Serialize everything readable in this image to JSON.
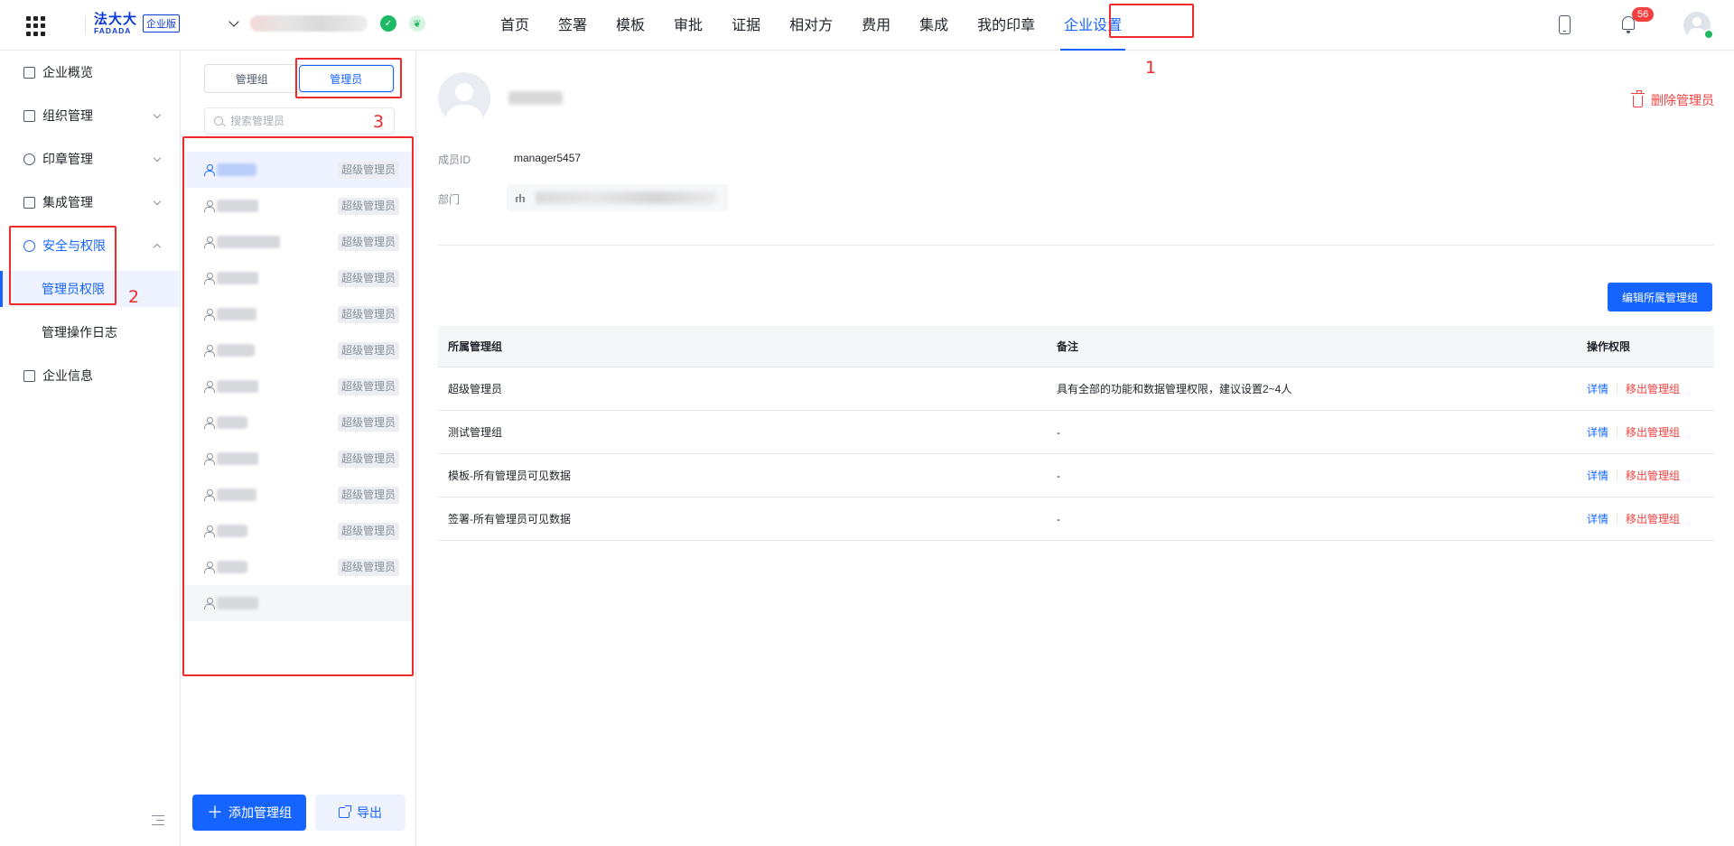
{
  "brand": {
    "name_cn": "法大大",
    "name_en": "FADADA",
    "edition": "企业版"
  },
  "nav": {
    "items": [
      {
        "label": "首页"
      },
      {
        "label": "签署"
      },
      {
        "label": "模板"
      },
      {
        "label": "审批"
      },
      {
        "label": "证据"
      },
      {
        "label": "相对方"
      },
      {
        "label": "费用"
      },
      {
        "label": "集成"
      },
      {
        "label": "我的印章"
      },
      {
        "label": "企业设置",
        "active": true
      }
    ]
  },
  "notifications": {
    "count": "56"
  },
  "annotations": {
    "one": "1",
    "two": "2",
    "three": "3"
  },
  "sidebar": {
    "items": [
      {
        "label": "企业概览"
      },
      {
        "label": "组织管理"
      },
      {
        "label": "印章管理"
      },
      {
        "label": "集成管理"
      },
      {
        "label": "安全与权限"
      },
      {
        "label": "管理员权限"
      },
      {
        "label": "管理操作日志"
      },
      {
        "label": "企业信息"
      }
    ]
  },
  "midpanel": {
    "tabs": [
      {
        "label": "管理组"
      },
      {
        "label": "管理员",
        "active": true
      }
    ],
    "search_placeholder": "搜索管理员",
    "role_tag": "超级管理员",
    "add_button": "添加管理组",
    "export_button": "导出"
  },
  "detail": {
    "delete_label": "删除管理员",
    "member_id_label": "成员ID",
    "member_id_value": "manager5457",
    "department_label": "部门",
    "edit_group_button": "编辑所属管理组",
    "table": {
      "headers": [
        "所属管理组",
        "备注",
        "操作权限"
      ],
      "rows": [
        {
          "group": "超级管理员",
          "note": "具有全部的功能和数据管理权限，建议设置2~4人"
        },
        {
          "group": "测试管理组",
          "note": "-"
        },
        {
          "group": "模板-所有管理员可见数据",
          "note": "-"
        },
        {
          "group": "签署-所有管理员可见数据",
          "note": "-"
        }
      ],
      "action_detail": "详情",
      "action_remove": "移出管理组"
    }
  },
  "colors": {
    "primary": "#1664ff",
    "danger": "#f53f3f",
    "annotation": "#ef2a2a"
  }
}
